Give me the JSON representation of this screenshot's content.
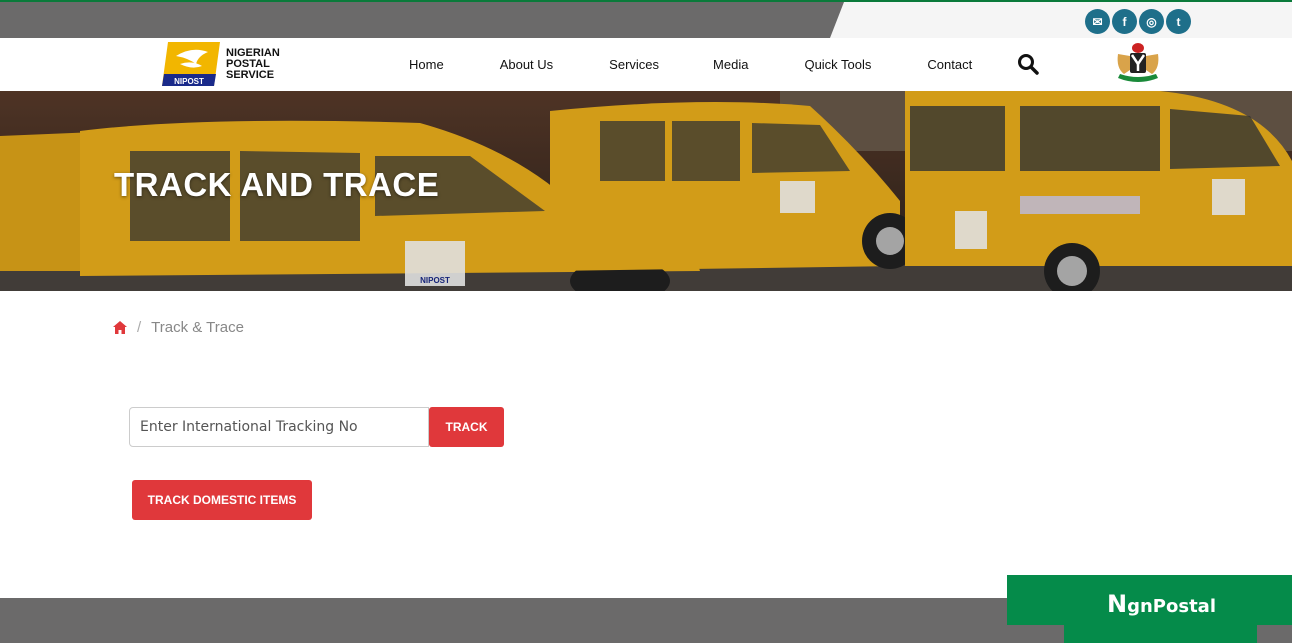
{
  "social": [
    "✉",
    "f",
    "◎",
    "t"
  ],
  "brand": {
    "logo_badge": "NIPOST",
    "line1": "NIGERIAN",
    "line2": "POSTAL",
    "line3": "SERVICE"
  },
  "nav": {
    "items": [
      "Home",
      "About Us",
      "Services",
      "Media",
      "Quick Tools",
      "Contact"
    ]
  },
  "hero": {
    "title": "TRACK AND TRACE",
    "van_label": "NIPOST"
  },
  "breadcrumb": {
    "current": "Track & Trace"
  },
  "tracking": {
    "placeholder": "Enter International Tracking No",
    "button": "TRACK",
    "domestic_button": "TRACK DOMESTIC ITEMS"
  },
  "widget": {
    "prefix": "N",
    "rest": "gnPostal"
  },
  "colors": {
    "accent": "#e0383b",
    "brand_green": "#058b4a",
    "social": "#1e6f8a"
  }
}
